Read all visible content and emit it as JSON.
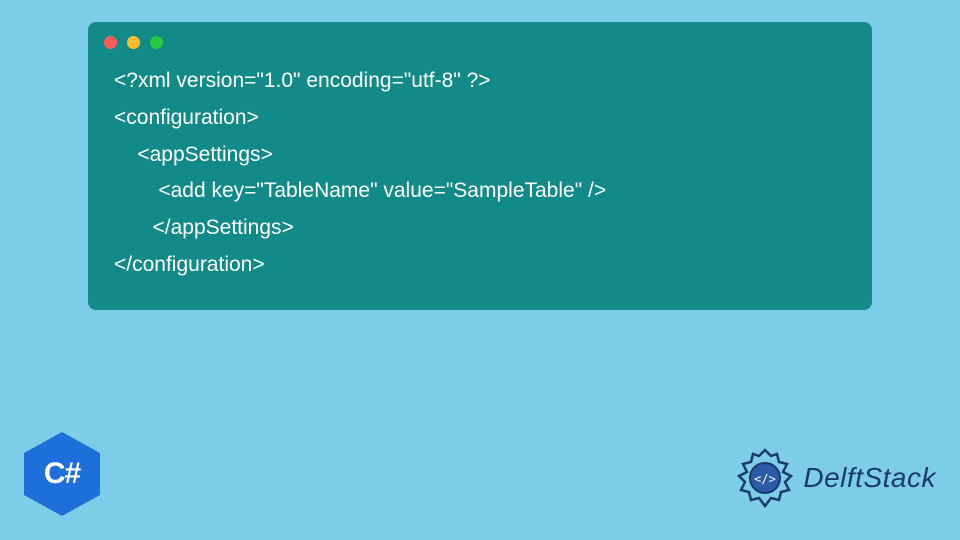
{
  "code": {
    "lines": [
      "<?xml version=\"1.0\" encoding=\"utf-8\" ?>",
      "<configuration>",
      "    <appSettings>",
      "     <add key=\"TableName\" value=\"SampleTable\" />",
      "    </appSettings>",
      "</configuration>"
    ]
  },
  "badges": {
    "csharp": "C#",
    "brand": "DelftStack"
  },
  "colors": {
    "page_bg": "#7ecde8",
    "window_bg": "#118a88",
    "code_fg": "#ffffff",
    "csharp_hex": "#1e6fd9",
    "brand_text": "#1a3a6e"
  }
}
